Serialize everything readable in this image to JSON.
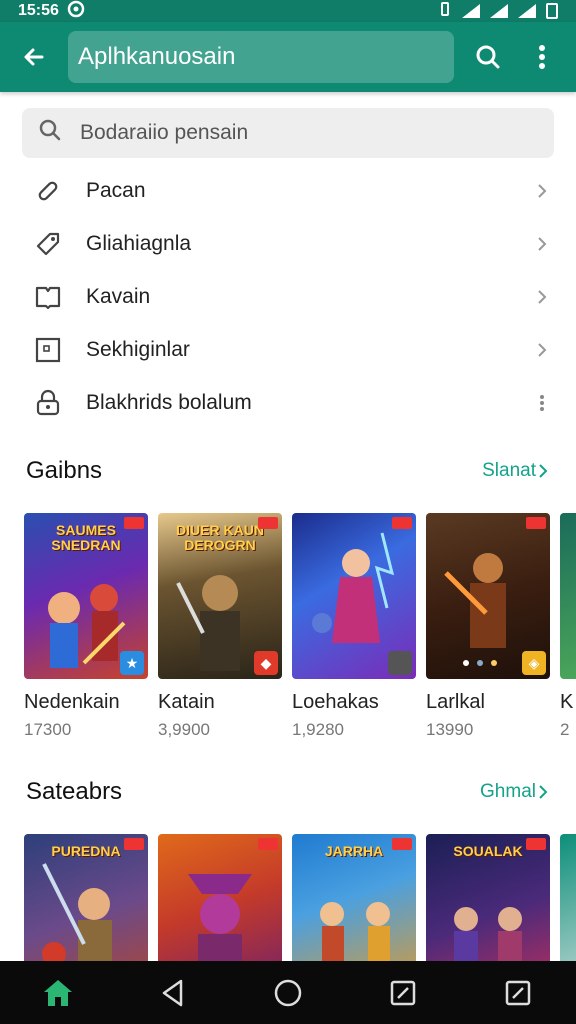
{
  "status": {
    "time": "15:56"
  },
  "appbar": {
    "title": "Aplhkanuosain"
  },
  "search": {
    "placeholder": "Bodaraiio pensain"
  },
  "menu": [
    {
      "label": "Pacan",
      "icon": "link-icon",
      "trail": "chevron"
    },
    {
      "label": "Gliahiagnla",
      "icon": "tag-icon",
      "trail": "chevron"
    },
    {
      "label": "Kavain",
      "icon": "book-icon",
      "trail": "chevron"
    },
    {
      "label": "Sekhiginlar",
      "icon": "image-icon",
      "trail": "chevron"
    },
    {
      "label": "Blakhrids bolalum",
      "icon": "lock-icon",
      "trail": "dots"
    }
  ],
  "games": {
    "title": "Gaibns",
    "link": "Slanat",
    "items": [
      {
        "name": "Nedenkain",
        "count": "17300",
        "art_title": "SAUMES SNEDRAN",
        "colors": [
          "#2a4fb0",
          "#c8432a"
        ]
      },
      {
        "name": "Katain",
        "count": "3,9900",
        "art_title": "DIUER KAUN DEROGRN",
        "colors": [
          "#3a3222",
          "#c79a4e"
        ]
      },
      {
        "name": "Loehakas",
        "count": "1,9280",
        "art_title": "",
        "colors": [
          "#1b2c8c",
          "#7b2bb8"
        ]
      },
      {
        "name": "Larlkal",
        "count": "13990",
        "art_title": "",
        "colors": [
          "#3a1e10",
          "#d27a2a"
        ]
      },
      {
        "name": "K",
        "count": "2",
        "art_title": "",
        "colors": [
          "#1a6b5a",
          "#55b35a"
        ]
      }
    ]
  },
  "stars": {
    "title": "Sateabrs",
    "link": "Ghmal",
    "items": [
      {
        "art_title": "PUREDNA",
        "colors": [
          "#2d3f7a",
          "#b4472c"
        ]
      },
      {
        "art_title": "",
        "colors": [
          "#e06a1a",
          "#6b1f6e"
        ]
      },
      {
        "art_title": "JARRHA",
        "colors": [
          "#1f7bd0",
          "#e39a2a"
        ]
      },
      {
        "art_title": "SOUALAK",
        "colors": [
          "#1b1f55",
          "#c0305c"
        ]
      },
      {
        "art_title": "",
        "colors": [
          "#0c8f7a",
          "#e8e8e8"
        ]
      }
    ]
  },
  "colors": {
    "accent": "#0f8a72",
    "link": "#14a38a",
    "home_active": "#2bb673"
  }
}
